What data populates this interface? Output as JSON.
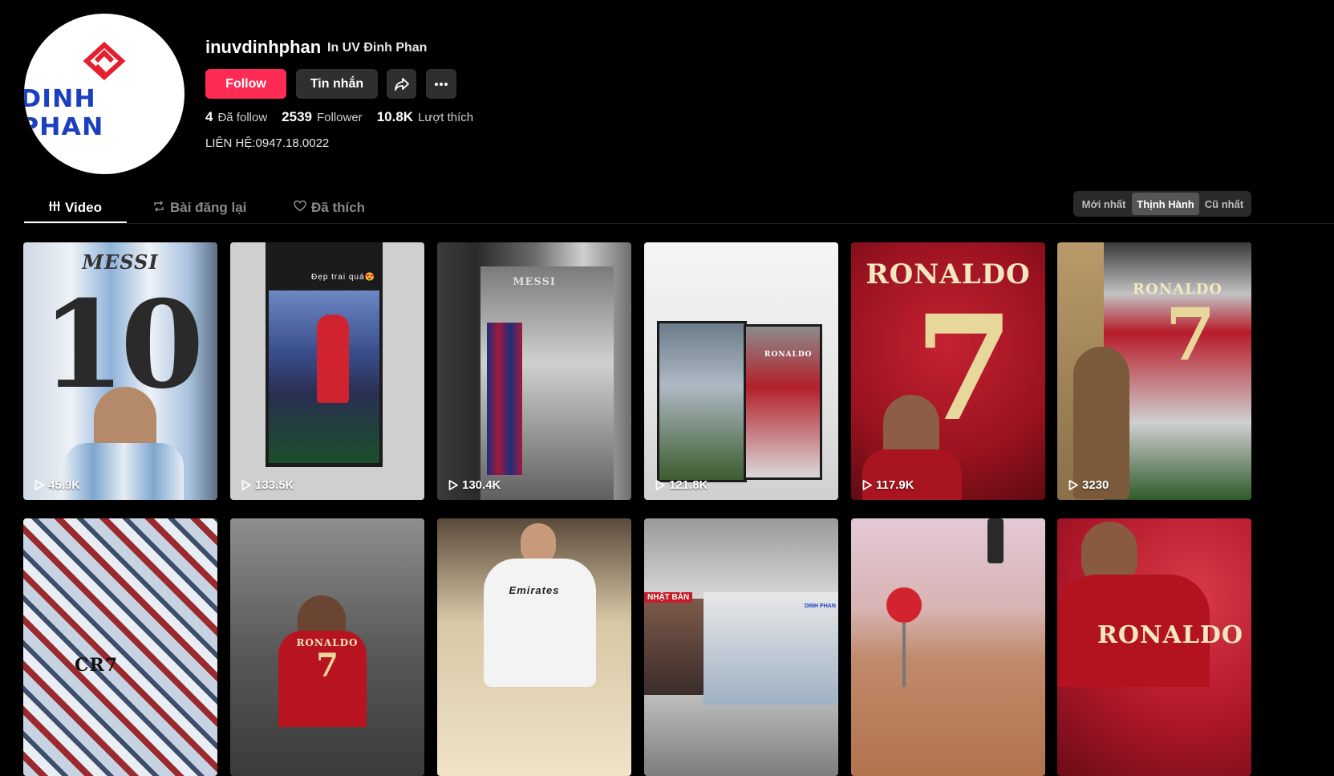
{
  "profile": {
    "logo_text": "DINH PHAN",
    "username": "inuvdinhphan",
    "display_name": "In UV Đinh Phan",
    "follow_label": "Follow",
    "message_label": "Tin nhắn",
    "share_icon": "share-icon",
    "more_icon": "more-icon",
    "stats": [
      {
        "value": "4",
        "label": "Đã follow"
      },
      {
        "value": "2539",
        "label": "Follower"
      },
      {
        "value": "10.8K",
        "label": "Lượt thích"
      }
    ],
    "bio": "LIÊN HỆ:0947.18.0022",
    "accent_color": "#fe2c55"
  },
  "tabs": [
    {
      "label": "Video",
      "icon": "grid-icon",
      "active": true
    },
    {
      "label": "Bài đăng lại",
      "icon": "repost-icon",
      "active": false
    },
    {
      "label": "Đã thích",
      "icon": "liked-icon",
      "active": false
    }
  ],
  "sort_options": [
    {
      "label": "Mới nhất",
      "active": false
    },
    {
      "label": "Thịnh Hành",
      "active": true
    },
    {
      "label": "Cũ nhất",
      "active": false
    }
  ],
  "videos": [
    {
      "views": "45.9K",
      "overlay_text": "MESSI",
      "number": "10"
    },
    {
      "views": "133.5K",
      "overlay_text": "Đẹp trai quá😍"
    },
    {
      "views": "130.4K",
      "overlay_text": "MESSI"
    },
    {
      "views": "121.8K",
      "overlay_text": "RONALDO"
    },
    {
      "views": "117.9K",
      "overlay_text": "RONALDO",
      "number": "7"
    },
    {
      "views": "3230",
      "overlay_text": "RONALDO",
      "number": "7"
    },
    {
      "views": "",
      "overlay_text": "CR7"
    },
    {
      "views": "",
      "overlay_text": "RONALDO",
      "number": "7"
    },
    {
      "views": "",
      "overlay_text": "Emirates"
    },
    {
      "views": "",
      "overlay_text": "NHẬT BẢN",
      "brand": "DINH PHAN"
    },
    {
      "views": ""
    },
    {
      "views": "",
      "overlay_text": "RONALDO"
    }
  ]
}
